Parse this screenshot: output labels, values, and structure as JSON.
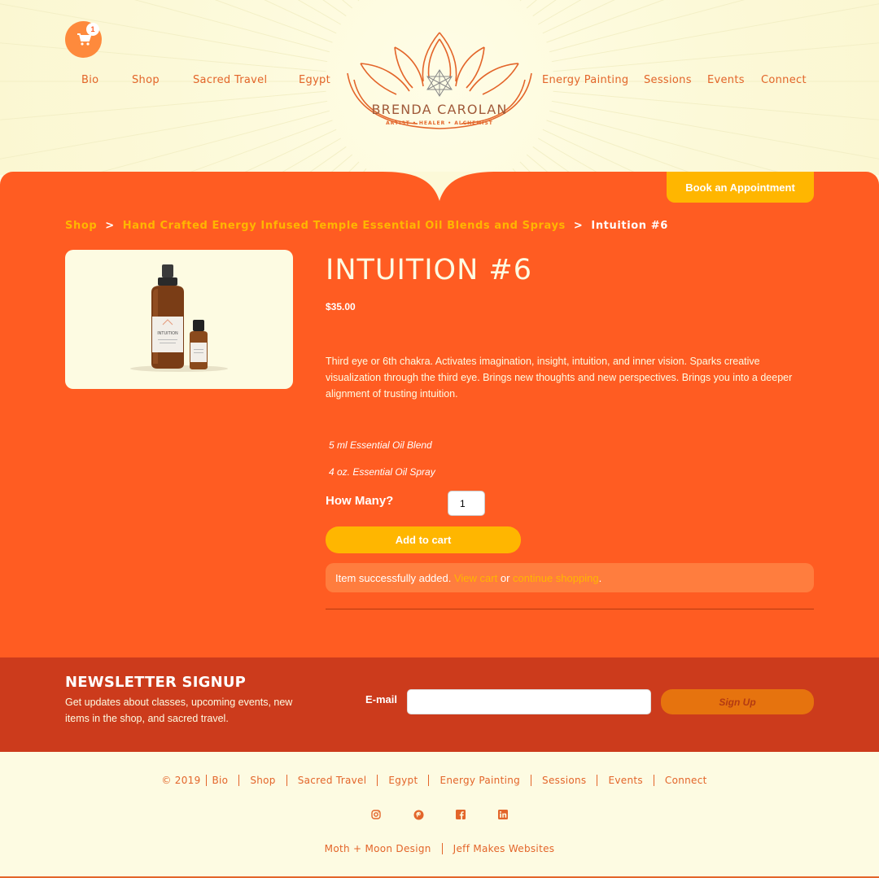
{
  "header": {
    "cart_count": "1",
    "nav_left": [
      "Bio",
      "Shop",
      "Sacred Travel",
      "Egypt"
    ],
    "nav_right": [
      "Energy Painting",
      "Sessions",
      "Events",
      "Connect"
    ],
    "logo_name": "BRENDA CAROLAN",
    "logo_tagline": "ARTIST • HEALER • ALCHEMIST"
  },
  "book_button": "Book an Appointment",
  "breadcrumb": {
    "shop": "Shop",
    "category": "Hand Crafted Energy Infused Temple Essential Oil Blends and Sprays",
    "current": "Intuition #6",
    "separator": ">"
  },
  "product": {
    "bottle_label": "INTUITION",
    "title": "INTUITION #6",
    "price": "$35.00",
    "description": "Third eye or 6th chakra. Activates imagination, insight, intuition, and inner vision. Sparks creative visualization through the third eye. Brings new thoughts and new perspectives. Brings you into a deeper alignment of trusting intuition.",
    "variant_1": "5 ml Essential Oil  Blend",
    "variant_2": "4 oz. Essential Oil Spray",
    "qty_label": "How Many?",
    "qty_value": "1",
    "add_to_cart": "Add to cart"
  },
  "notice": {
    "text": "Item successfully added.",
    "view_cart": "View cart",
    "or": "or",
    "continue": "continue shopping",
    "period": "."
  },
  "newsletter": {
    "title": "NEWSLETTER SIGNUP",
    "text": "Get updates about classes, upcoming events, new items in the shop, and sacred travel.",
    "email_label": "E-mail",
    "email_value": "",
    "signup": "Sign Up"
  },
  "footer": {
    "copyright": "© 2019",
    "links": [
      "Bio",
      "Shop",
      "Sacred Travel",
      "Egypt",
      "Energy Painting",
      "Sessions",
      "Events",
      "Connect"
    ],
    "social": [
      "instagram-icon",
      "pinterest-icon",
      "facebook-icon",
      "linkedin-icon"
    ],
    "credits": [
      "Moth + Moon Design",
      "Jeff Makes Websites"
    ]
  },
  "colors": {
    "orange": "#ff5c22",
    "yellow": "#ffb600",
    "cream": "#fdfbe2",
    "newsletter_bg": "#cc3b1c",
    "nav_text": "#e3652a"
  }
}
